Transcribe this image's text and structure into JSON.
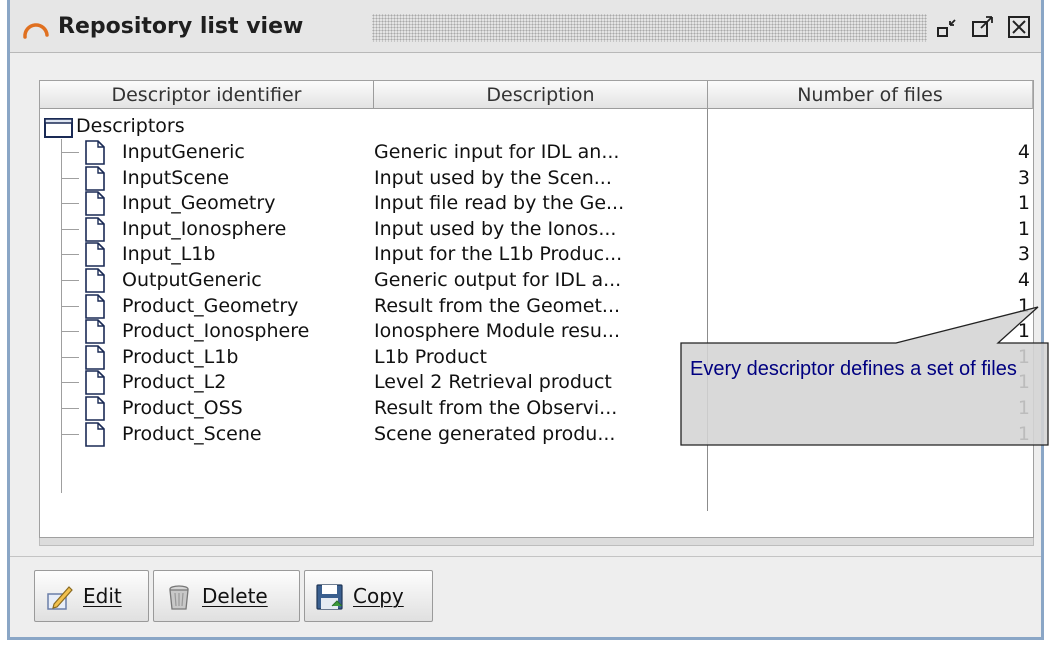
{
  "window": {
    "title": "Repository list view",
    "icons": [
      "arc-app-icon",
      "minimize-icon",
      "maximize-icon",
      "close-icon"
    ]
  },
  "table": {
    "columns": [
      "Descriptor identifier",
      "Description",
      "Number of files"
    ],
    "root_label": "Descriptors",
    "rows": [
      {
        "id": "InputGeneric",
        "description": "Generic input for IDL an...",
        "files": "4"
      },
      {
        "id": "InputScene",
        "description": "Input used by the Scen...",
        "files": "3"
      },
      {
        "id": "Input_Geometry",
        "description": "Input file read by the Ge...",
        "files": "1"
      },
      {
        "id": "Input_Ionosphere",
        "description": "Input used by the Ionos...",
        "files": "1"
      },
      {
        "id": "Input_L1b",
        "description": "Input for the L1b Produc...",
        "files": "3"
      },
      {
        "id": "OutputGeneric",
        "description": "Generic output for IDL a...",
        "files": "4"
      },
      {
        "id": "Product_Geometry",
        "description": "Result from the Geomet...",
        "files": "1"
      },
      {
        "id": "Product_Ionosphere",
        "description": "Ionosphere Module resu...",
        "files": "1"
      },
      {
        "id": "Product_L1b",
        "description": "L1b Product",
        "files": "1"
      },
      {
        "id": "Product_L2",
        "description": "Level 2 Retrieval product",
        "files": "1"
      },
      {
        "id": "Product_OSS",
        "description": "Result from the Observi...",
        "files": "1"
      },
      {
        "id": "Product_Scene",
        "description": "Scene generated produ...",
        "files": "1"
      }
    ]
  },
  "toolbar": {
    "edit_label": "Edit",
    "delete_label": "Delete",
    "copy_label": "Copy",
    "icons": [
      "edit-icon",
      "trash-icon",
      "floppy-disk-icon"
    ]
  },
  "callout": {
    "text": "Every descriptor defines a set of files"
  },
  "colors": {
    "window_border": "#8aa6c6",
    "callout_fill": "#d4d4d4",
    "callout_text": "#000080"
  }
}
